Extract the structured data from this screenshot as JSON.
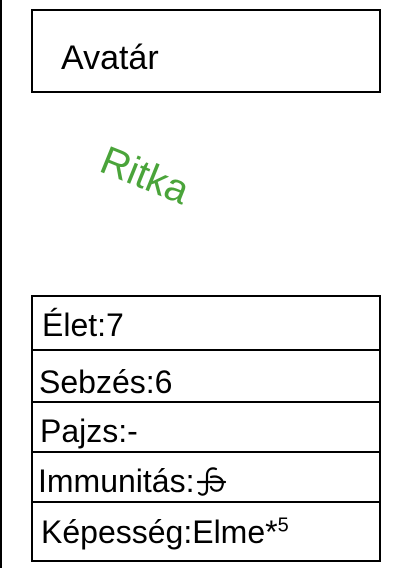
{
  "card": {
    "title": "Avatár",
    "rarity": "Ritka",
    "rarity_color": "#4aa43a",
    "stats": {
      "life": "Élet:7",
      "damage": "Sebzés:6",
      "shield": "Pajzs:-",
      "immunity_label": "Immunitás:",
      "immunity_icon": "crossed-swirl-icon",
      "ability_label": "Képesség:Elme*",
      "ability_superscript": "5"
    }
  }
}
